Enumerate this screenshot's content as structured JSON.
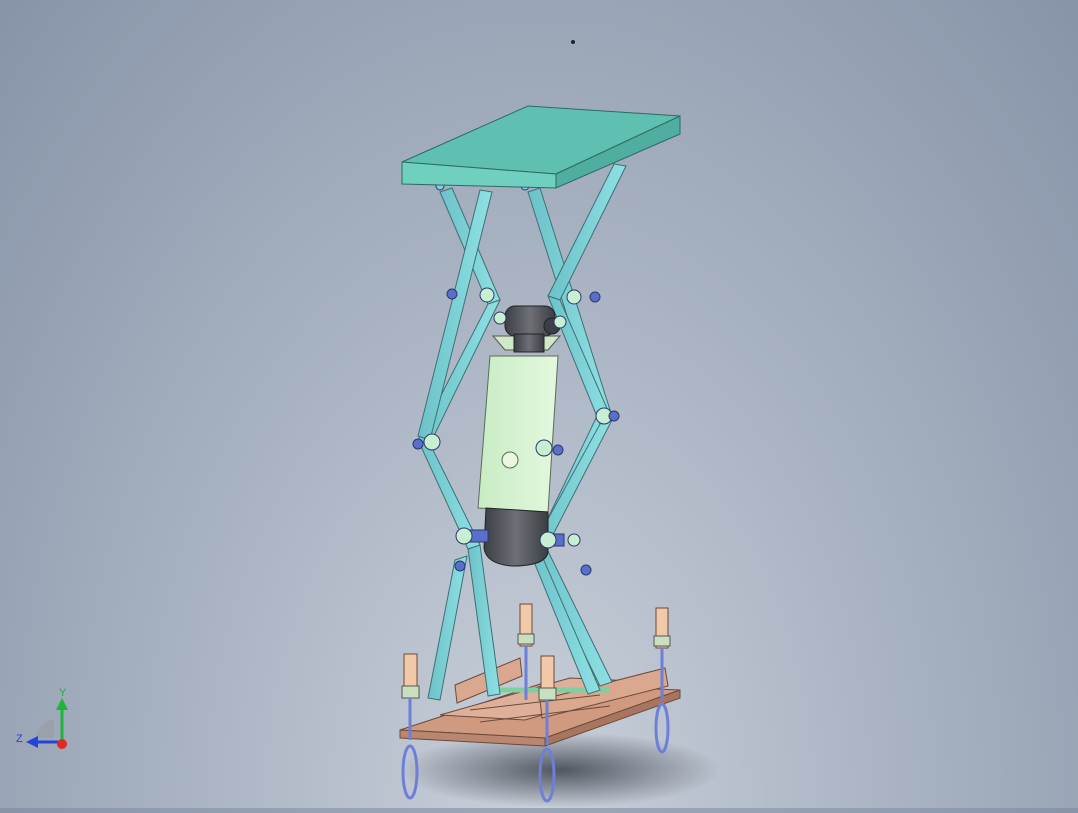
{
  "viewport": {
    "background_top": "#8794a8",
    "background_bottom": "#c9d0da"
  },
  "colors": {
    "platform": "#5fc0b2",
    "scissor_arm": "#7fd0d6",
    "cylinder_housing": "#d4f2cf",
    "cylinder_end": "#55585e",
    "base_frame": "#d7a48a",
    "caster_post": "#f1c9a8",
    "wheel": "#6f7fd8",
    "pin": "#5a6fc8"
  },
  "triad": {
    "axis_y_label": "Y",
    "axis_z_label": "Z",
    "axis_x_color": "#e02a2a",
    "axis_y_color": "#1fb43a",
    "axis_z_color": "#2544d6"
  }
}
